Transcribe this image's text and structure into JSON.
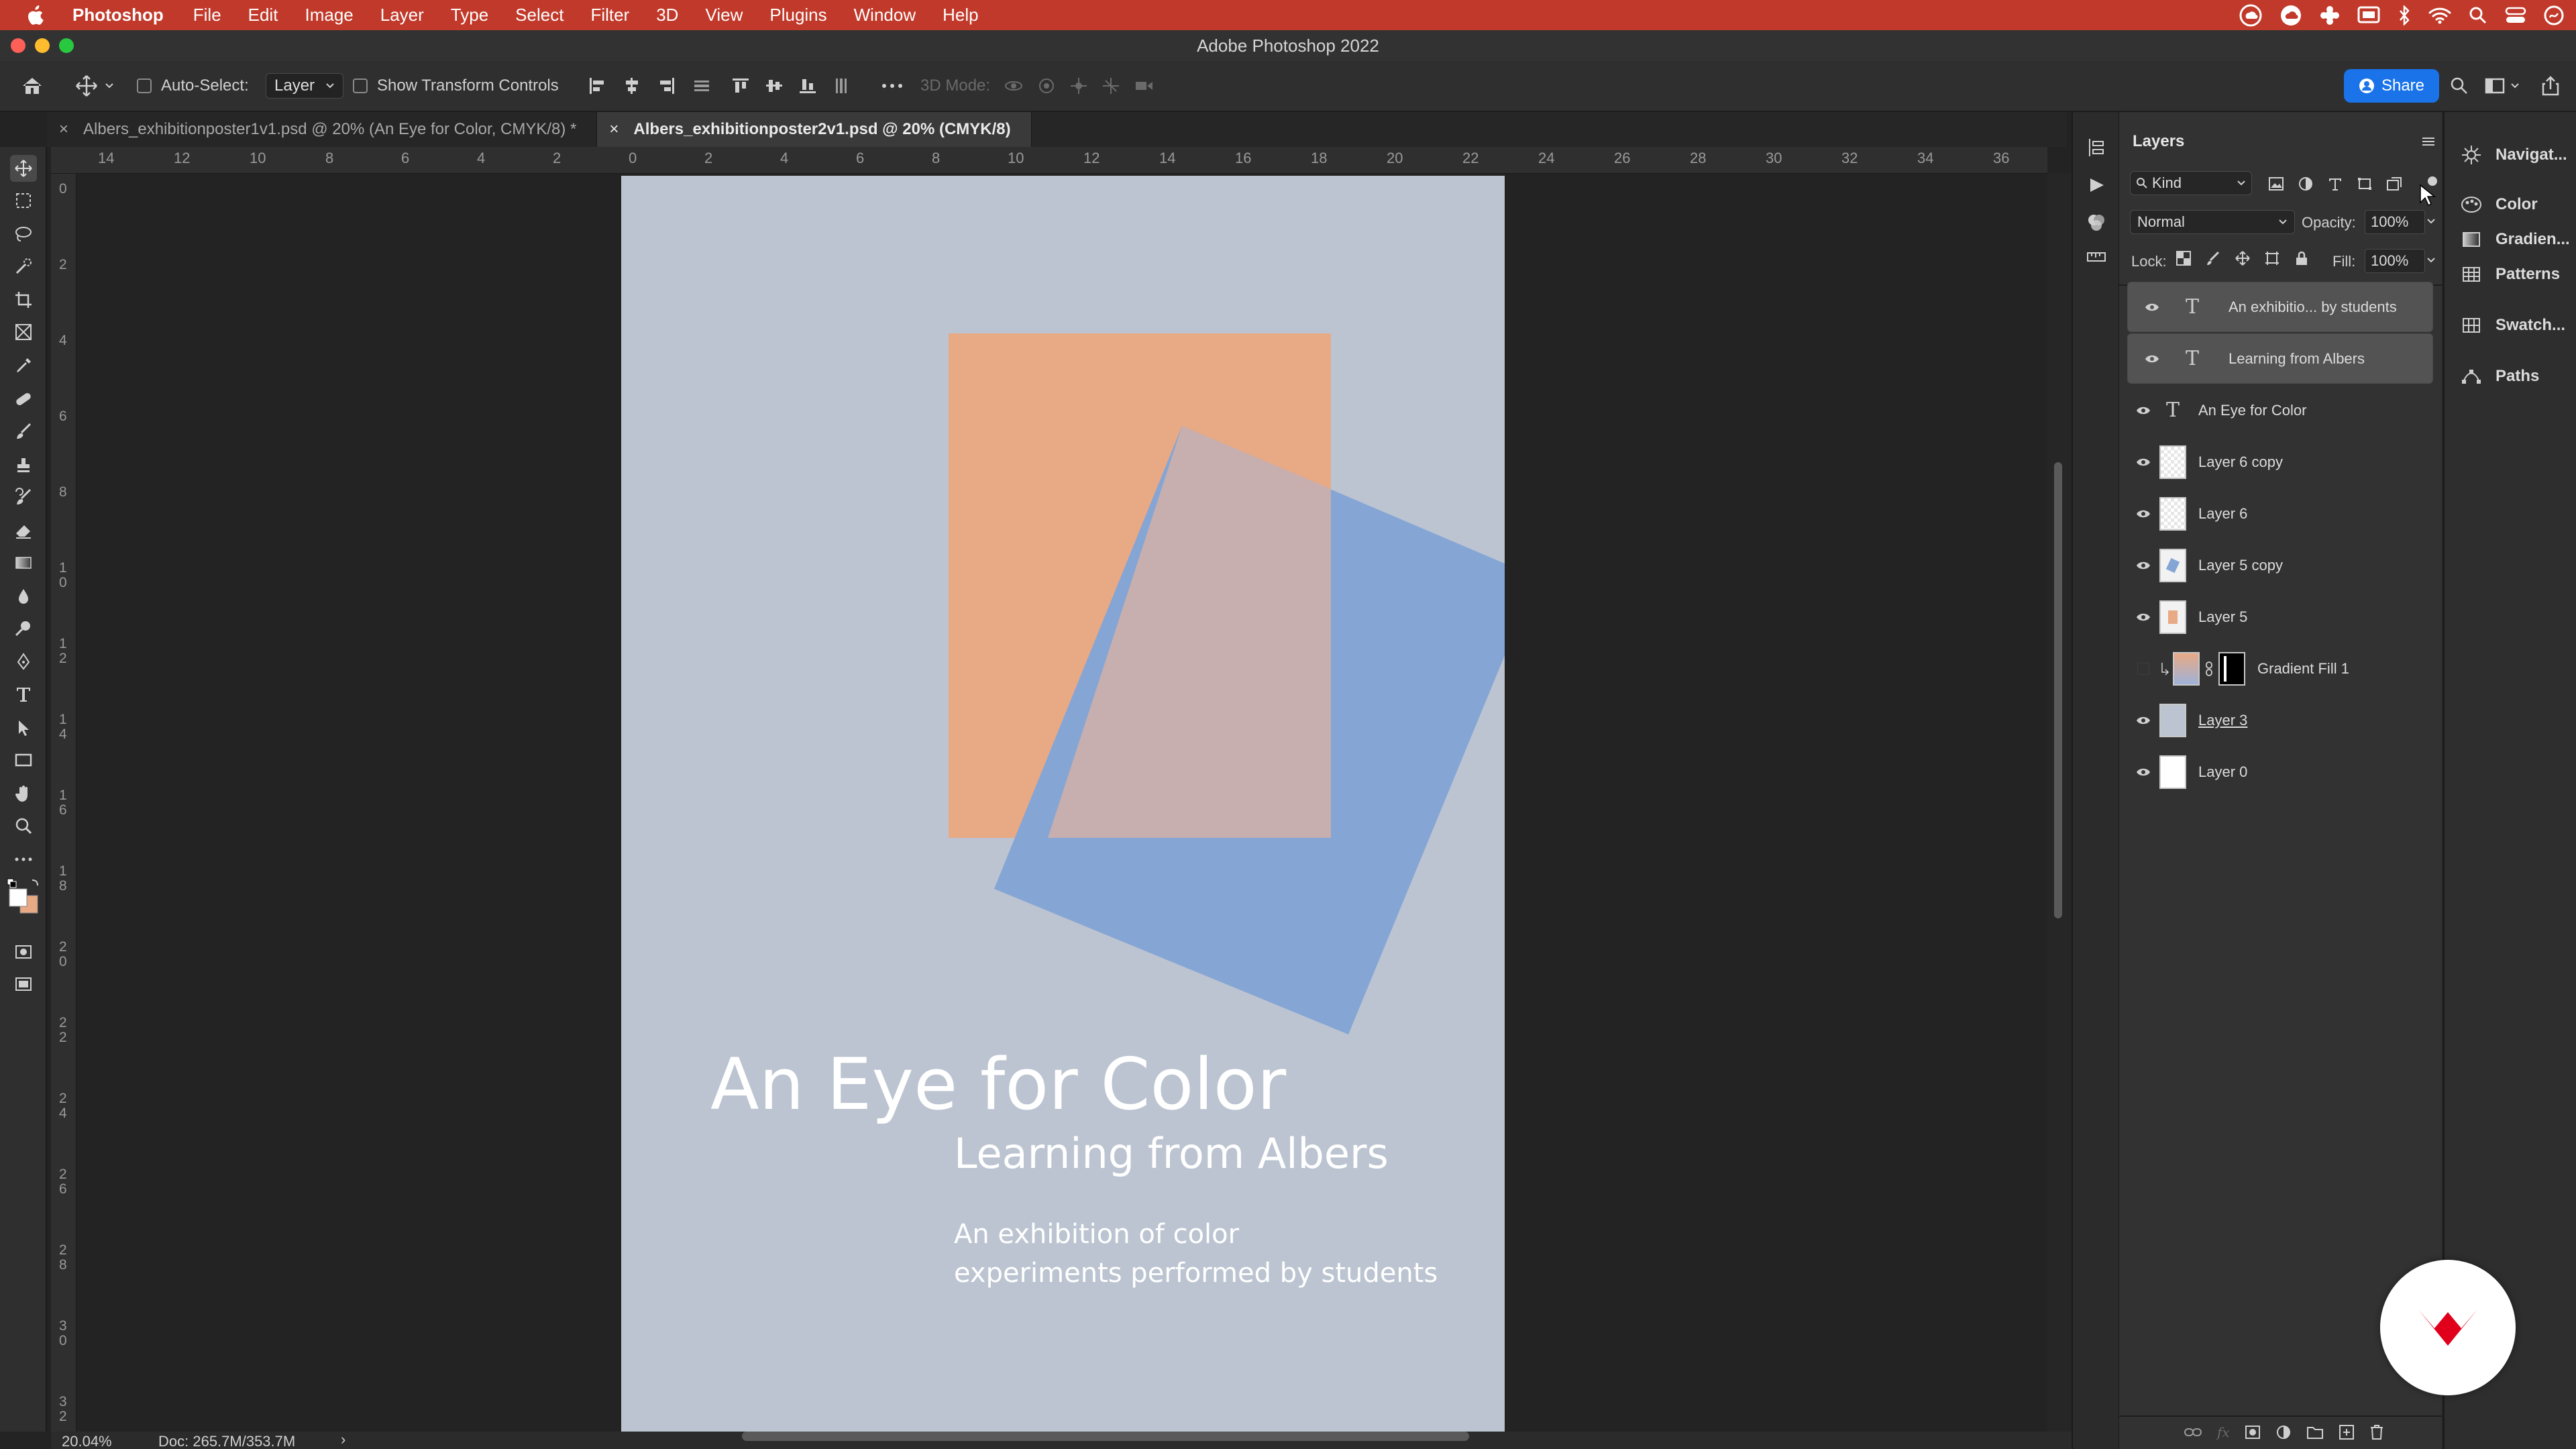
{
  "menubar": {
    "app_name": "Photoshop",
    "items": [
      "File",
      "Edit",
      "Image",
      "Layer",
      "Type",
      "Select",
      "Filter",
      "3D",
      "View",
      "Plugins",
      "Window",
      "Help"
    ]
  },
  "window": {
    "title": "Adobe Photoshop 2022"
  },
  "options_bar": {
    "auto_select_label": "Auto-Select:",
    "auto_select_target": "Layer",
    "transform_controls_label": "Show Transform Controls",
    "mode_3d_label": "3D Mode:",
    "share_label": "Share"
  },
  "tabs": [
    {
      "label": "Albers_exhibitionposter1v1.psd @ 20% (An Eye for Color, CMYK/8) *",
      "active": false
    },
    {
      "label": "Albers_exhibitionposter2v1.psd @ 20% (CMYK/8)",
      "active": true
    }
  ],
  "ruler": {
    "top_labels": [
      "14",
      "12",
      "10",
      "8",
      "6",
      "4",
      "2",
      "0",
      "2",
      "4",
      "6",
      "8",
      "10",
      "12",
      "14",
      "16",
      "18",
      "20",
      "22",
      "24",
      "26",
      "28",
      "30",
      "32",
      "34",
      "36"
    ],
    "left_labels": [
      "0",
      "2",
      "4",
      "6",
      "8",
      "10",
      "12",
      "14",
      "16",
      "18",
      "20",
      "22",
      "24",
      "26",
      "28",
      "30",
      "32"
    ]
  },
  "poster": {
    "title": "An Eye for Color",
    "subtitle": "Learning from Albers",
    "body_line1": "An exhibition of color",
    "body_line2": "experiments performed by students",
    "colors": {
      "background": "#bbc4d0",
      "orange": "#e8a985",
      "blue": "#85a5d5",
      "overlap": "#c6afae"
    }
  },
  "status": {
    "zoom": "20.04%",
    "doc": "Doc: 265.7M/353.7M"
  },
  "layers_panel": {
    "title": "Layers",
    "filter_kind": "Kind",
    "blend_mode": "Normal",
    "opacity_label": "Opacity:",
    "opacity_value": "100%",
    "lock_label": "Lock:",
    "fill_label": "Fill:",
    "fill_value": "100%",
    "layers": [
      {
        "name": "An exhibitio... by students",
        "type": "text",
        "visible": true,
        "selected": true
      },
      {
        "name": "Learning from Albers",
        "type": "text",
        "visible": true,
        "selected": true
      },
      {
        "name": "An Eye for Color",
        "type": "text",
        "visible": true,
        "selected": false
      },
      {
        "name": "Layer 6 copy",
        "type": "pixel",
        "visible": true,
        "selected": false
      },
      {
        "name": "Layer 6",
        "type": "pixel",
        "visible": true,
        "selected": false
      },
      {
        "name": "Layer 5 copy",
        "type": "pixel",
        "visible": true,
        "selected": false
      },
      {
        "name": "Layer 5",
        "type": "pixel",
        "visible": true,
        "selected": false
      },
      {
        "name": "Gradient Fill 1",
        "type": "fill",
        "visible": false,
        "selected": false
      },
      {
        "name": "Layer 3",
        "type": "pixel",
        "visible": true,
        "selected": false
      },
      {
        "name": "Layer 0",
        "type": "pixel",
        "visible": true,
        "selected": false
      }
    ]
  },
  "side_panels": [
    "Navigat...",
    "Color",
    "Gradien...",
    "Patterns",
    "Swatch...",
    "Paths"
  ]
}
